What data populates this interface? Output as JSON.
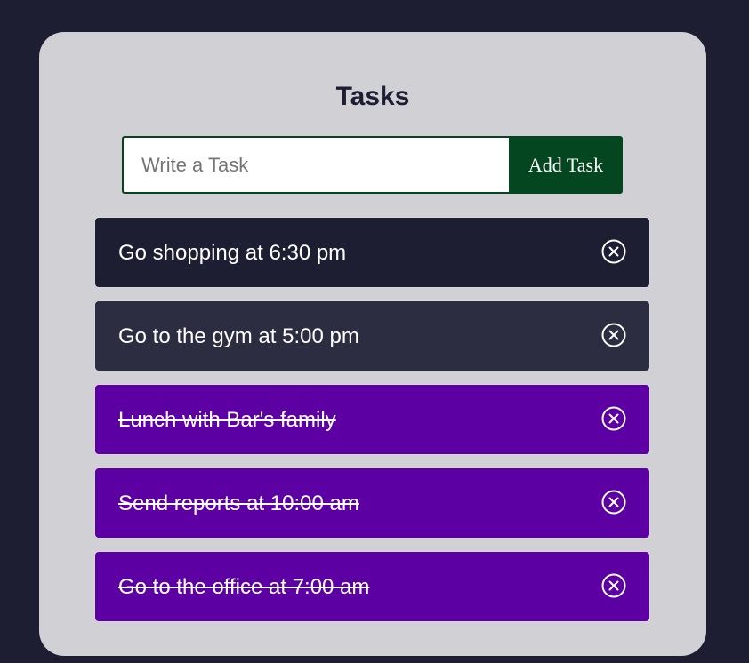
{
  "header": {
    "title": "Tasks"
  },
  "form": {
    "input_placeholder": "Write a Task",
    "input_value": "",
    "add_label": "Add Task"
  },
  "tasks": [
    {
      "text": "Go shopping at 6:30 pm",
      "completed": false,
      "delete_icon": "close-circle-icon"
    },
    {
      "text": "Go to the gym at 5:00 pm",
      "completed": false,
      "delete_icon": "close-circle-icon"
    },
    {
      "text": "Lunch with Bar's family",
      "completed": true,
      "delete_icon": "close-circle-icon"
    },
    {
      "text": "Send reports at 10:00 am",
      "completed": true,
      "delete_icon": "close-circle-icon"
    },
    {
      "text": "Go to the office at 7:00 am",
      "completed": true,
      "delete_icon": "close-circle-icon"
    }
  ],
  "colors": {
    "page_background": "#1e1e32",
    "card_background": "#d1d0d5",
    "accent_green": "#034620",
    "pending_task": "#1e1e32",
    "pending_task_alt": "#2d2d42",
    "completed_task": "#5c00a3"
  }
}
